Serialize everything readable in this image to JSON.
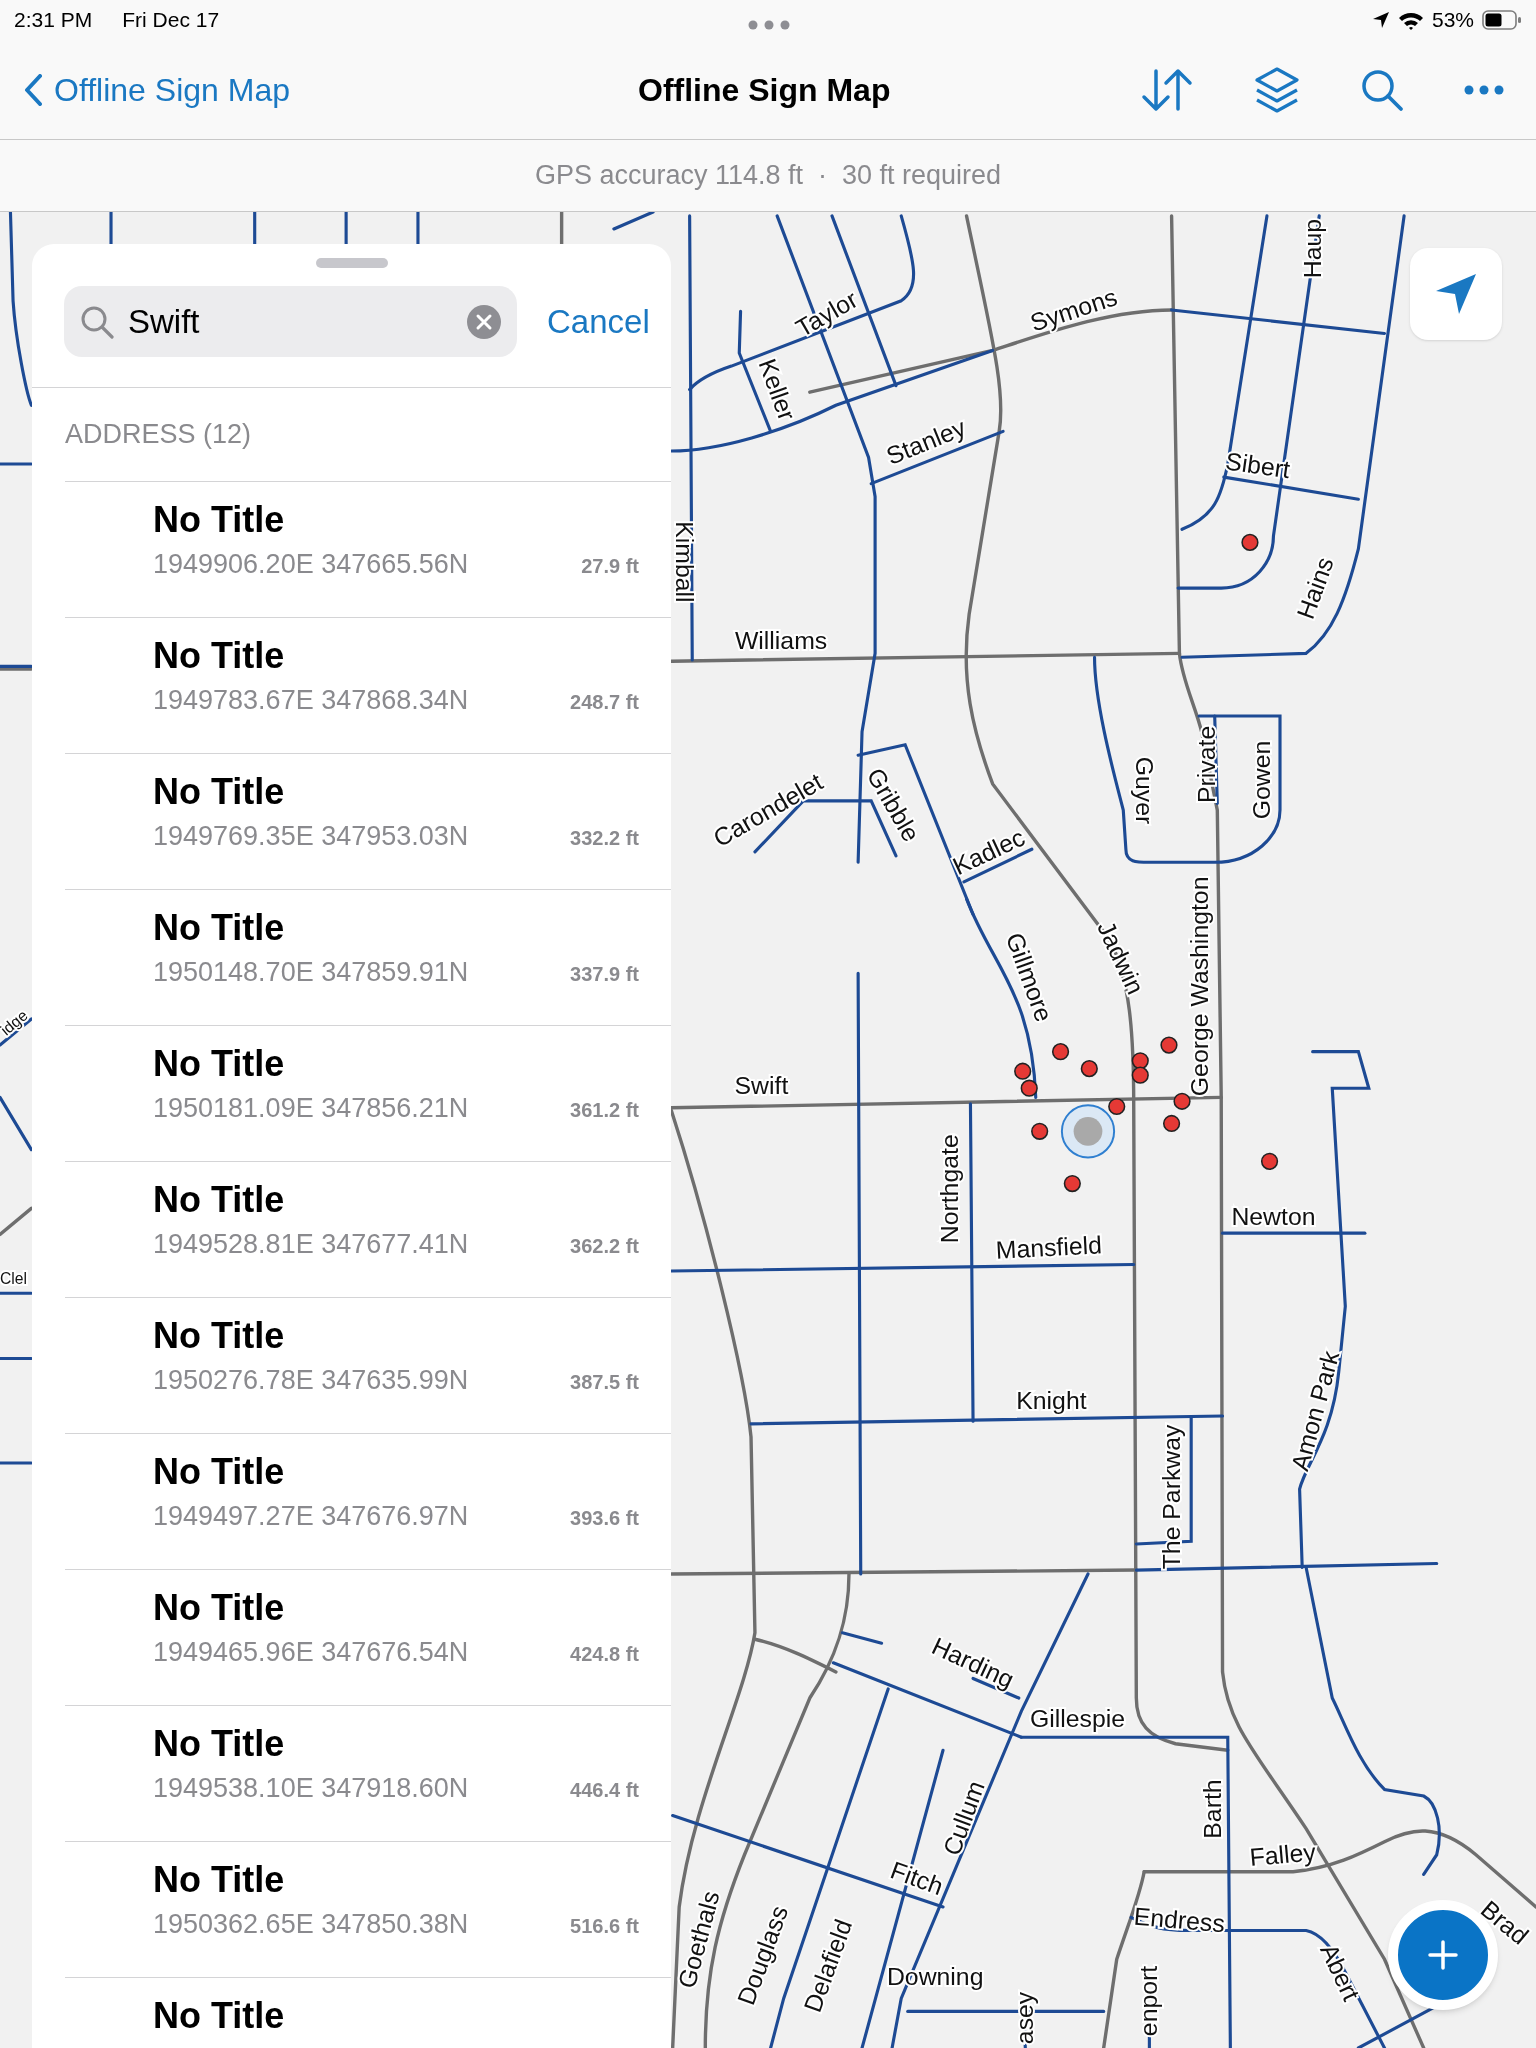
{
  "status_bar": {
    "time": "2:31 PM",
    "date": "Fri Dec 17",
    "battery": "53%"
  },
  "nav_bar": {
    "back": "Offline Sign Map",
    "title": "Offline Sign Map"
  },
  "gps_banner": {
    "text": "GPS accuracy 114.8 ft  ·  30 ft required"
  },
  "search_panel": {
    "search": {
      "value": "Swift"
    },
    "cancel": "Cancel",
    "section": "ADDRESS (12)",
    "results": [
      {
        "title": "No Title",
        "coordinates": "1949906.20E 347665.56N",
        "distance": "27.9 ft"
      },
      {
        "title": "No Title",
        "coordinates": "1949783.67E 347868.34N",
        "distance": "248.7 ft"
      },
      {
        "title": "No Title",
        "coordinates": "1949769.35E 347953.03N",
        "distance": "332.2 ft"
      },
      {
        "title": "No Title",
        "coordinates": "1950148.70E 347859.91N",
        "distance": "337.9 ft"
      },
      {
        "title": "No Title",
        "coordinates": "1950181.09E 347856.21N",
        "distance": "361.2 ft"
      },
      {
        "title": "No Title",
        "coordinates": "1949528.81E 347677.41N",
        "distance": "362.2 ft"
      },
      {
        "title": "No Title",
        "coordinates": "1950276.78E 347635.99N",
        "distance": "387.5 ft"
      },
      {
        "title": "No Title",
        "coordinates": "1949497.27E 347676.97N",
        "distance": "393.6 ft"
      },
      {
        "title": "No Title",
        "coordinates": "1949465.96E 347676.54N",
        "distance": "424.8 ft"
      },
      {
        "title": "No Title",
        "coordinates": "1949538.10E 347918.60N",
        "distance": "446.4 ft"
      },
      {
        "title": "No Title",
        "coordinates": "1950362.65E 347850.38N",
        "distance": "516.6 ft"
      },
      {
        "title": "No Title"
      }
    ]
  },
  "map": {
    "street_labels": [
      "Haup",
      "Taylor",
      "Symons",
      "Keller",
      "Stanley",
      "Sibert",
      "Kimball",
      "Hains",
      "Williams",
      "Carondelet",
      "Gribble",
      "Guyer",
      "Private",
      "Gowen",
      "Kadlec",
      "Gillmore",
      "Jadwin",
      "George Washington",
      "idge",
      "Swift",
      "Northgate",
      "Newton",
      "Mansfield",
      "Clel",
      "Amon Park",
      "Knight",
      "The Parkway",
      "Harding",
      "Gillespie",
      "Cullum",
      "Barth",
      "Falley",
      "Fitch",
      "Endress",
      "Goethals",
      "Douglass",
      "Delafield",
      "Abert",
      "Downing",
      "Brad",
      "asey",
      "enport"
    ]
  }
}
